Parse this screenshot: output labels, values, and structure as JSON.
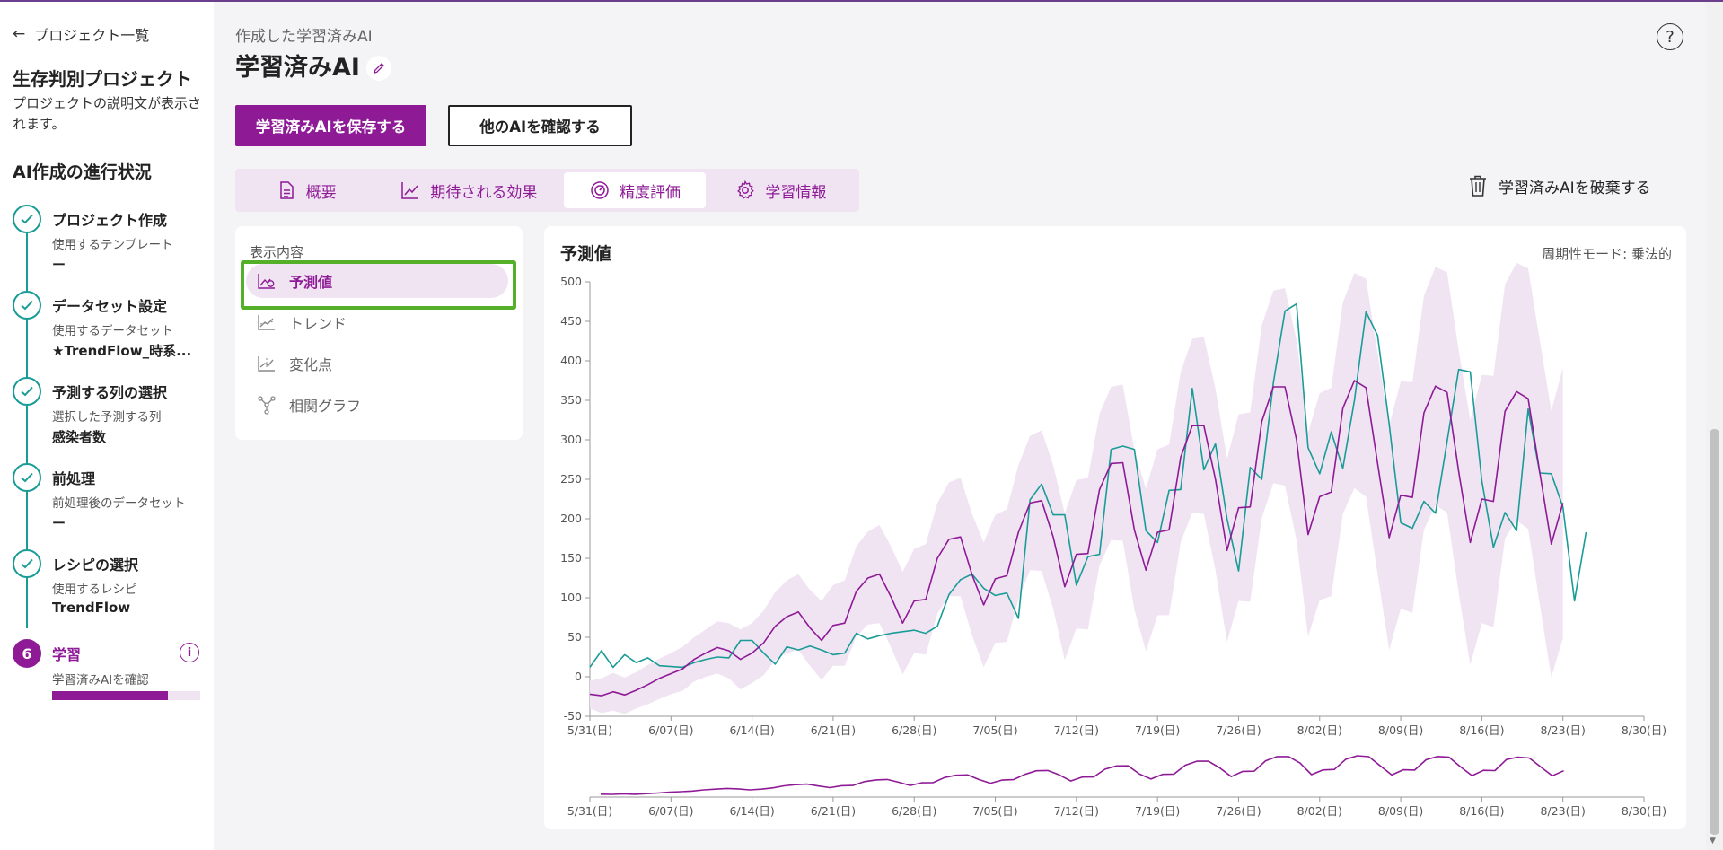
{
  "sidebar": {
    "back_label": "プロジェクト一覧",
    "project_title": "生存判別プロジェクト",
    "project_desc": "プロジェクトの説明文が表示されます。",
    "progress_title": "AI作成の進行状況",
    "steps": [
      {
        "name": "プロジェクト作成",
        "sub": "使用するテンプレート",
        "value": "ー"
      },
      {
        "name": "データセット設定",
        "sub": "使用するデータセット",
        "value": "★TrendFlow_時系..."
      },
      {
        "name": "予測する列の選択",
        "sub": "選択した予測する列",
        "value": "感染者数"
      },
      {
        "name": "前処理",
        "sub": "前処理後のデータセット",
        "value": "ー"
      },
      {
        "name": "レシピの選択",
        "sub": "使用するレシピ",
        "value": "TrendFlow"
      },
      {
        "name": "学習",
        "sub": "学習済みAIを確認",
        "number": "6",
        "progress": 0.78
      }
    ]
  },
  "header": {
    "breadcrumb": "作成した学習済みAI",
    "title": "学習済みAI",
    "save_button": "学習済みAIを保存する",
    "other_button": "他のAIを確認する",
    "help": "?"
  },
  "tabs": [
    {
      "label": "概要",
      "icon": "document-icon"
    },
    {
      "label": "期待される効果",
      "icon": "line-chart-icon"
    },
    {
      "label": "精度評価",
      "icon": "gauge-icon",
      "active": true
    },
    {
      "label": "学習情報",
      "icon": "gear-icon"
    }
  ],
  "discard_label": "学習済みAIを破棄する",
  "menu": {
    "heading": "表示内容",
    "items": [
      {
        "label": "予測値",
        "active": true
      },
      {
        "label": "トレンド"
      },
      {
        "label": "変化点"
      },
      {
        "label": "相関グラフ"
      }
    ]
  },
  "chart_panel": {
    "title": "予測値",
    "mode": "周期性モード: 乗法的"
  },
  "colors": {
    "accent": "#8e1a96",
    "teal": "#1a9c96",
    "band": "#f0e4f3",
    "highlight": "#53b028"
  },
  "chart_data": {
    "type": "line",
    "y_ticks": [
      -50,
      0,
      50,
      100,
      150,
      200,
      250,
      300,
      350,
      400,
      450,
      500
    ],
    "ylim": [
      -50,
      500
    ],
    "x_ticks": [
      "5/31(日)",
      "6/07(日)",
      "6/14(日)",
      "6/21(日)",
      "6/28(日)",
      "7/05(日)",
      "7/12(日)",
      "7/19(日)",
      "7/26(日)",
      "8/02(日)",
      "8/09(日)",
      "8/16(日)",
      "8/23(日)",
      "8/30(日)"
    ],
    "x_day_range": [
      0,
      91
    ],
    "actual": [
      12,
      33,
      12,
      28,
      18,
      24,
      14,
      13,
      12,
      18,
      22,
      25,
      24,
      46,
      46,
      30,
      16,
      38,
      34,
      39,
      34,
      28,
      30,
      55,
      48,
      52,
      55,
      57,
      59,
      55,
      64,
      104,
      123,
      130,
      112,
      103,
      106,
      74,
      224,
      244,
      205,
      205,
      116,
      152,
      155,
      288,
      292,
      288,
      185,
      170,
      236,
      237,
      365,
      262,
      295,
      200,
      134,
      265,
      250,
      372,
      463,
      472,
      290,
      257,
      310,
      264,
      350,
      462,
      432,
      320,
      195,
      188,
      222,
      207,
      298,
      389,
      386,
      248,
      164,
      208,
      185,
      339,
      258,
      257,
      215,
      96,
      183
    ],
    "predicted": [
      -22,
      -24,
      -19,
      -23,
      -17,
      -10,
      -2,
      4,
      10,
      22,
      30,
      37,
      33,
      22,
      30,
      43,
      64,
      76,
      82,
      62,
      46,
      65,
      68,
      108,
      125,
      130,
      101,
      68,
      96,
      98,
      150,
      174,
      177,
      129,
      91,
      124,
      128,
      183,
      220,
      223,
      177,
      114,
      155,
      156,
      237,
      270,
      271,
      186,
      135,
      183,
      186,
      278,
      318,
      318,
      250,
      160,
      214,
      215,
      323,
      367,
      367,
      300,
      180,
      228,
      234,
      340,
      375,
      366,
      270,
      176,
      230,
      227,
      334,
      368,
      360,
      260,
      170,
      225,
      222,
      336,
      361,
      352,
      259,
      168,
      220
    ],
    "band_upper": [
      -5,
      -2,
      5,
      -1,
      6,
      15,
      23,
      30,
      38,
      50,
      60,
      70,
      68,
      60,
      68,
      84,
      107,
      122,
      130,
      110,
      96,
      116,
      122,
      165,
      184,
      192,
      165,
      133,
      162,
      168,
      220,
      246,
      252,
      206,
      170,
      205,
      212,
      268,
      305,
      312,
      268,
      207,
      249,
      252,
      333,
      367,
      370,
      287,
      238,
      288,
      294,
      386,
      428,
      430,
      365,
      276,
      332,
      335,
      445,
      489,
      492,
      427,
      309,
      359,
      366,
      474,
      511,
      504,
      410,
      318,
      374,
      373,
      482,
      519,
      512,
      414,
      325,
      382,
      381,
      497,
      524,
      517,
      426,
      337,
      391
    ],
    "band_lower": [
      -40,
      -46,
      -43,
      -47,
      -40,
      -35,
      -28,
      -22,
      -18,
      -6,
      0,
      4,
      -2,
      -16,
      -8,
      2,
      21,
      30,
      34,
      14,
      -4,
      14,
      14,
      51,
      66,
      68,
      37,
      3,
      30,
      28,
      80,
      102,
      102,
      52,
      12,
      43,
      44,
      98,
      135,
      134,
      86,
      21,
      61,
      60,
      141,
      173,
      172,
      85,
      32,
      78,
      78,
      170,
      208,
      206,
      135,
      44,
      96,
      95,
      201,
      245,
      242,
      173,
      51,
      97,
      102,
      206,
      239,
      228,
      130,
      34,
      86,
      81,
      186,
      217,
      208,
      106,
      15,
      68,
      63,
      175,
      198,
      187,
      92,
      -1,
      49
    ]
  }
}
